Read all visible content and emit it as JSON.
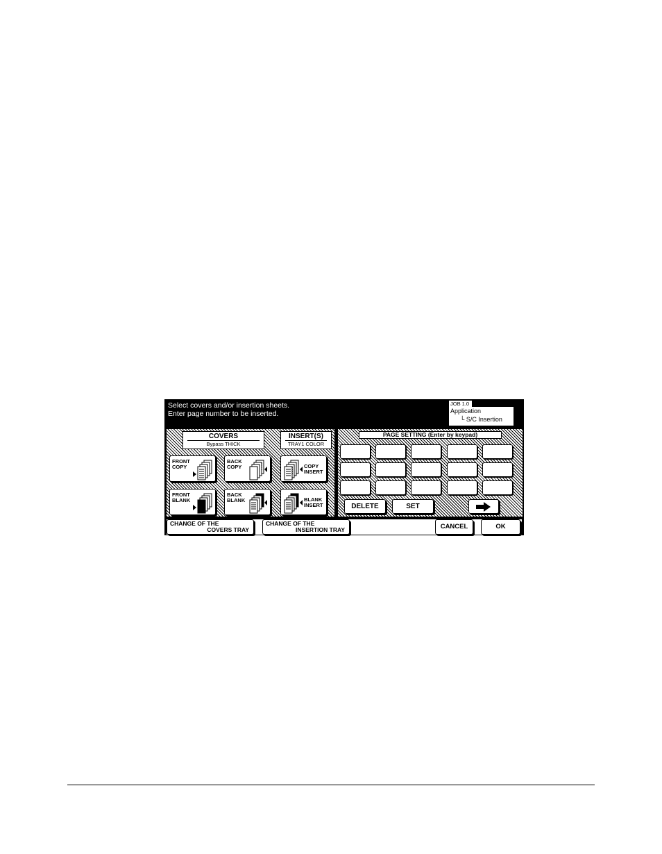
{
  "header": {
    "message_line1": "Select covers and/or insertion sheets.",
    "message_line2": "Enter page number to be inserted.",
    "job_tag": "JOB 1.0",
    "breadcrumb_root": "Application",
    "breadcrumb_child": "S/C Insertion"
  },
  "covers": {
    "title": "COVERS",
    "subtitle": "Bypass    THICK",
    "front_copy": [
      "FRONT",
      "COPY"
    ],
    "back_copy": [
      "BACK",
      "COPY"
    ],
    "front_blank": [
      "FRONT",
      "BLANK"
    ],
    "back_blank": [
      "BACK",
      "BLANK"
    ]
  },
  "inserts": {
    "title": "INSERT(S)",
    "subtitle": "TRAY1 COLOR",
    "copy_insert": [
      "COPY",
      "INSERT"
    ],
    "blank_insert": [
      "BLANK",
      "INSERT"
    ]
  },
  "page_setting": {
    "label": "PAGE SETTING (Enter by keypad)",
    "delete_label": "DELETE",
    "set_label": "SET",
    "next_icon": "arrow-right-icon"
  },
  "bottom": {
    "covers_tray": [
      "CHANGE OF THE",
      "COVERS TRAY"
    ],
    "insertion_tray": [
      "CHANGE OF THE",
      "INSERTION TRAY"
    ],
    "cancel_label": "CANCEL",
    "ok_label": "OK"
  }
}
